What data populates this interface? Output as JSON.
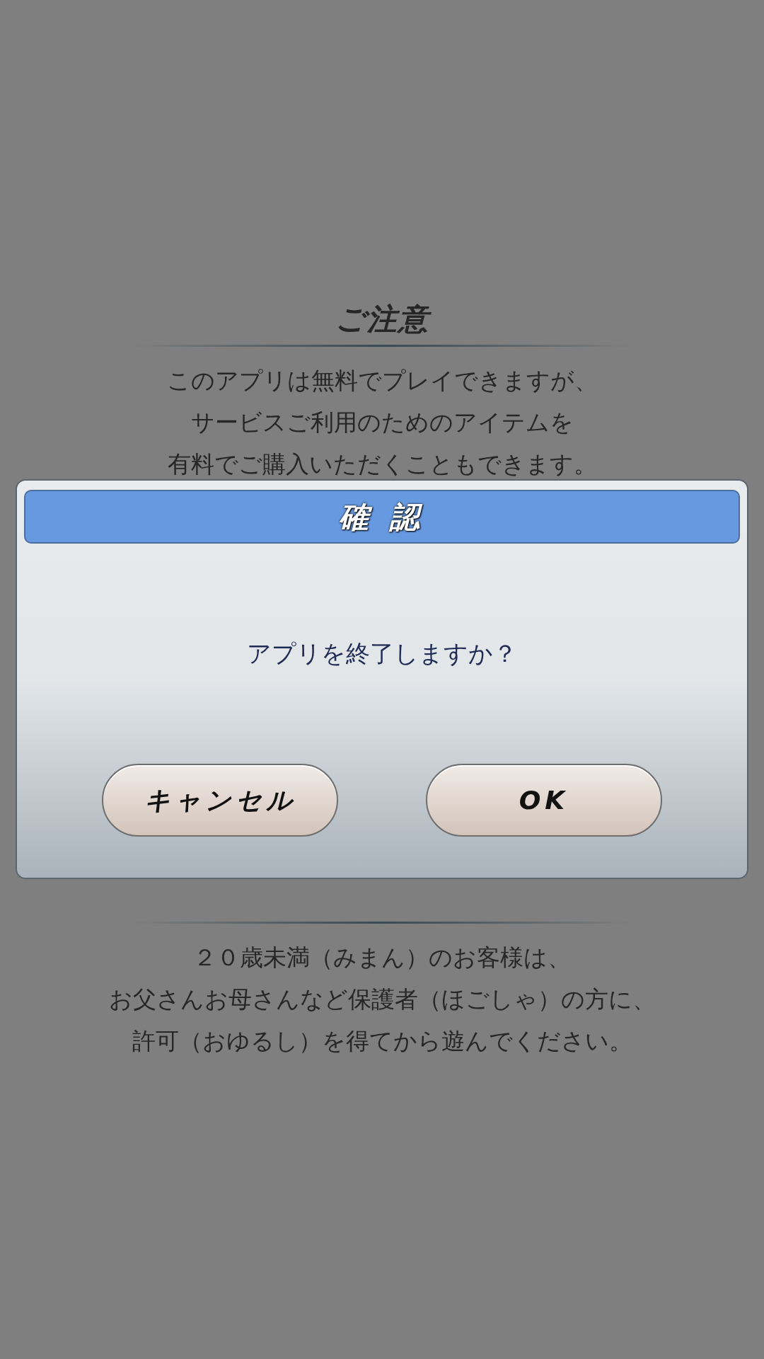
{
  "notice": {
    "title": "ご注意",
    "lines": [
      "このアプリは無料でプレイできますが、",
      "サービスご利用のためのアイテムを",
      "有料でご購入いただくこともできます。"
    ]
  },
  "minors": {
    "lines": [
      "２０歳未満（みまん）のお客様は、",
      "お父さんお母さんなど保護者（ほごしゃ）の方に、",
      "許可（おゆるし）を得てから遊んでください。"
    ]
  },
  "dialog": {
    "title": "確 認",
    "message": "アプリを終了しますか？",
    "buttons": [
      {
        "label": "キャンセル"
      },
      {
        "label": "OK"
      }
    ]
  }
}
